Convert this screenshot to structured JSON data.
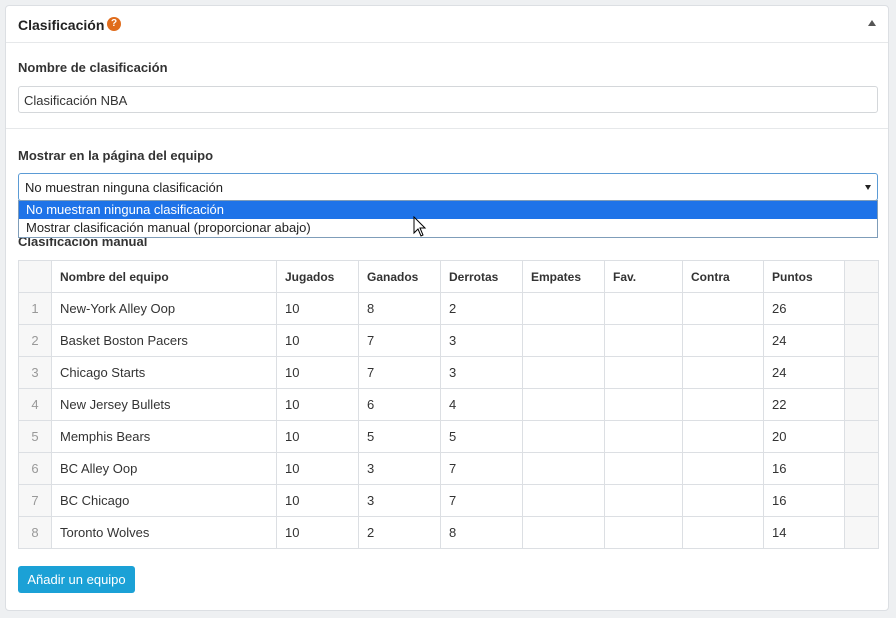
{
  "panel": {
    "title": "Clasificación",
    "help_icon": "?"
  },
  "name_field": {
    "label": "Nombre de clasificación",
    "value": "Clasificación NBA"
  },
  "team_page": {
    "label": "Mostrar en la página del equipo",
    "selected": "No muestran ninguna clasificación",
    "options": [
      "No muestran ninguna clasificación",
      "Mostrar clasificación manual (proporcionar abajo)"
    ]
  },
  "manual": {
    "label": "Clasificación manual",
    "columns": [
      "Nombre del equipo",
      "Jugados",
      "Ganados",
      "Derrotas",
      "Empates",
      "Fav.",
      "Contra",
      "Puntos"
    ],
    "rows": [
      {
        "n": "1",
        "team": "New-York Alley Oop",
        "played": "10",
        "won": "8",
        "lost": "2",
        "draws": "",
        "fav": "",
        "against": "",
        "points": "26"
      },
      {
        "n": "2",
        "team": "Basket Boston Pacers",
        "played": "10",
        "won": "7",
        "lost": "3",
        "draws": "",
        "fav": "",
        "against": "",
        "points": "24"
      },
      {
        "n": "3",
        "team": "Chicago Starts",
        "played": "10",
        "won": "7",
        "lost": "3",
        "draws": "",
        "fav": "",
        "against": "",
        "points": "24"
      },
      {
        "n": "4",
        "team": "New Jersey Bullets",
        "played": "10",
        "won": "6",
        "lost": "4",
        "draws": "",
        "fav": "",
        "against": "",
        "points": "22"
      },
      {
        "n": "5",
        "team": "Memphis Bears",
        "played": "10",
        "won": "5",
        "lost": "5",
        "draws": "",
        "fav": "",
        "against": "",
        "points": "20"
      },
      {
        "n": "6",
        "team": "BC Alley Oop",
        "played": "10",
        "won": "3",
        "lost": "7",
        "draws": "",
        "fav": "",
        "against": "",
        "points": "16"
      },
      {
        "n": "7",
        "team": "BC Chicago",
        "played": "10",
        "won": "3",
        "lost": "7",
        "draws": "",
        "fav": "",
        "against": "",
        "points": "16"
      },
      {
        "n": "8",
        "team": "Toronto Wolves",
        "played": "10",
        "won": "2",
        "lost": "8",
        "draws": "",
        "fav": "",
        "against": "",
        "points": "14"
      }
    ],
    "add_button": "Añadir un equipo"
  },
  "colors": {
    "accent": "#1ba1d6",
    "highlight": "#1e73e8",
    "help": "#e06c1c"
  }
}
